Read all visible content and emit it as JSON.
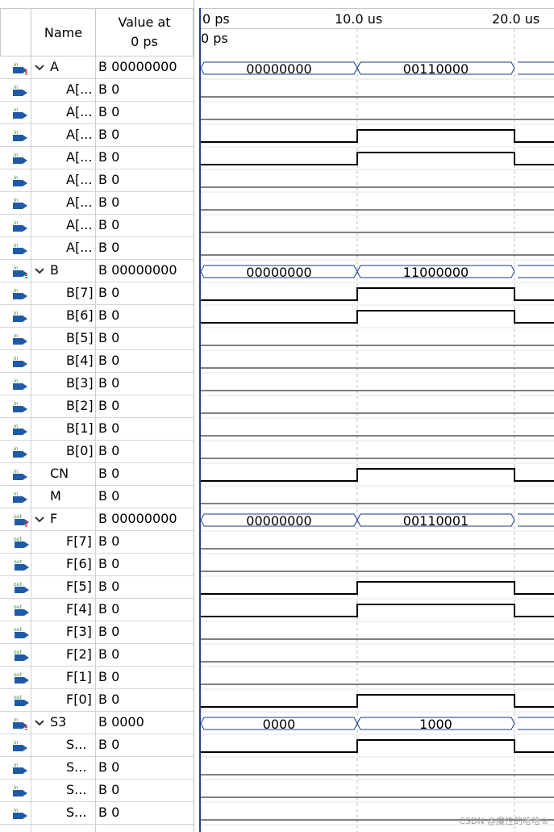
{
  "columns": {
    "name": "Name",
    "value": "Value at\n0 ps"
  },
  "timeline": {
    "ticks": [
      {
        "label": "0 ps",
        "t": 0
      },
      {
        "label": "10.0 us",
        "t": 10
      },
      {
        "label": "20.0 us",
        "t": 20
      }
    ],
    "cursor_label": "0 ps"
  },
  "signals": [
    {
      "name": "A",
      "value": "B 00000000",
      "dir": "in",
      "bus": true,
      "segments": [
        "00000000",
        "00110000"
      ]
    },
    {
      "name": "A[...",
      "value": "B 0",
      "dir": "in",
      "level": [
        0,
        0,
        0
      ]
    },
    {
      "name": "A[...",
      "value": "B 0",
      "dir": "in",
      "level": [
        0,
        0,
        0
      ]
    },
    {
      "name": "A[...",
      "value": "B 0",
      "dir": "in",
      "level": [
        0,
        1,
        0
      ]
    },
    {
      "name": "A[...",
      "value": "B 0",
      "dir": "in",
      "level": [
        0,
        1,
        0
      ]
    },
    {
      "name": "A[...",
      "value": "B 0",
      "dir": "in",
      "level": [
        0,
        0,
        0
      ]
    },
    {
      "name": "A[...",
      "value": "B 0",
      "dir": "in",
      "level": [
        0,
        0,
        0
      ]
    },
    {
      "name": "A[...",
      "value": "B 0",
      "dir": "in",
      "level": [
        0,
        0,
        0
      ]
    },
    {
      "name": "A[...",
      "value": "B 0",
      "dir": "in",
      "level": [
        0,
        0,
        0
      ]
    },
    {
      "name": "B",
      "value": "B 00000000",
      "dir": "in",
      "bus": true,
      "segments": [
        "00000000",
        "11000000"
      ]
    },
    {
      "name": "B[7]",
      "value": "B 0",
      "dir": "in",
      "level": [
        0,
        1,
        0
      ]
    },
    {
      "name": "B[6]",
      "value": "B 0",
      "dir": "in",
      "level": [
        0,
        1,
        0
      ]
    },
    {
      "name": "B[5]",
      "value": "B 0",
      "dir": "in",
      "level": [
        0,
        0,
        0
      ]
    },
    {
      "name": "B[4]",
      "value": "B 0",
      "dir": "in",
      "level": [
        0,
        0,
        0
      ]
    },
    {
      "name": "B[3]",
      "value": "B 0",
      "dir": "in",
      "level": [
        0,
        0,
        0
      ]
    },
    {
      "name": "B[2]",
      "value": "B 0",
      "dir": "in",
      "level": [
        0,
        0,
        0
      ]
    },
    {
      "name": "B[1]",
      "value": "B 0",
      "dir": "in",
      "level": [
        0,
        0,
        0
      ]
    },
    {
      "name": "B[0]",
      "value": "B 0",
      "dir": "in",
      "level": [
        0,
        0,
        0
      ]
    },
    {
      "name": "CN",
      "value": "B 0",
      "dir": "in",
      "level": [
        0,
        1,
        0
      ]
    },
    {
      "name": "M",
      "value": "B 0",
      "dir": "in",
      "level": [
        0,
        0,
        0
      ]
    },
    {
      "name": "F",
      "value": "B 00000000",
      "dir": "out",
      "bus": true,
      "segments": [
        "00000000",
        "00110001"
      ]
    },
    {
      "name": "F[7]",
      "value": "B 0",
      "dir": "out",
      "level": [
        0,
        0,
        0
      ]
    },
    {
      "name": "F[6]",
      "value": "B 0",
      "dir": "out",
      "level": [
        0,
        0,
        0
      ]
    },
    {
      "name": "F[5]",
      "value": "B 0",
      "dir": "out",
      "level": [
        0,
        1,
        0
      ]
    },
    {
      "name": "F[4]",
      "value": "B 0",
      "dir": "out",
      "level": [
        0,
        1,
        0
      ]
    },
    {
      "name": "F[3]",
      "value": "B 0",
      "dir": "out",
      "level": [
        0,
        0,
        0
      ]
    },
    {
      "name": "F[2]",
      "value": "B 0",
      "dir": "out",
      "level": [
        0,
        0,
        0
      ]
    },
    {
      "name": "F[1]",
      "value": "B 0",
      "dir": "out",
      "level": [
        0,
        0,
        0
      ]
    },
    {
      "name": "F[0]",
      "value": "B 0",
      "dir": "out",
      "level": [
        0,
        1,
        0
      ]
    },
    {
      "name": "S3",
      "value": "B 0000",
      "dir": "in",
      "bus": true,
      "segments": [
        "0000",
        "1000"
      ]
    },
    {
      "name": "S...",
      "value": "B 0",
      "dir": "in",
      "level": [
        0,
        1,
        0
      ]
    },
    {
      "name": "S...",
      "value": "B 0",
      "dir": "in",
      "level": [
        0,
        0,
        0
      ]
    },
    {
      "name": "S...",
      "value": "B 0",
      "dir": "in",
      "level": [
        0,
        0,
        0
      ]
    },
    {
      "name": "S...",
      "value": "B 0",
      "dir": "in",
      "level": [
        0,
        0,
        0
      ]
    }
  ],
  "colors": {
    "in_icon": "#1e5aa8",
    "in_text": "#2a8a2a",
    "out_text": "#2a8a2a",
    "cursor": "#2a3a9a",
    "bus_bits": "#d23a3a"
  },
  "watermark": "CSDN @魔性的哈哈®"
}
